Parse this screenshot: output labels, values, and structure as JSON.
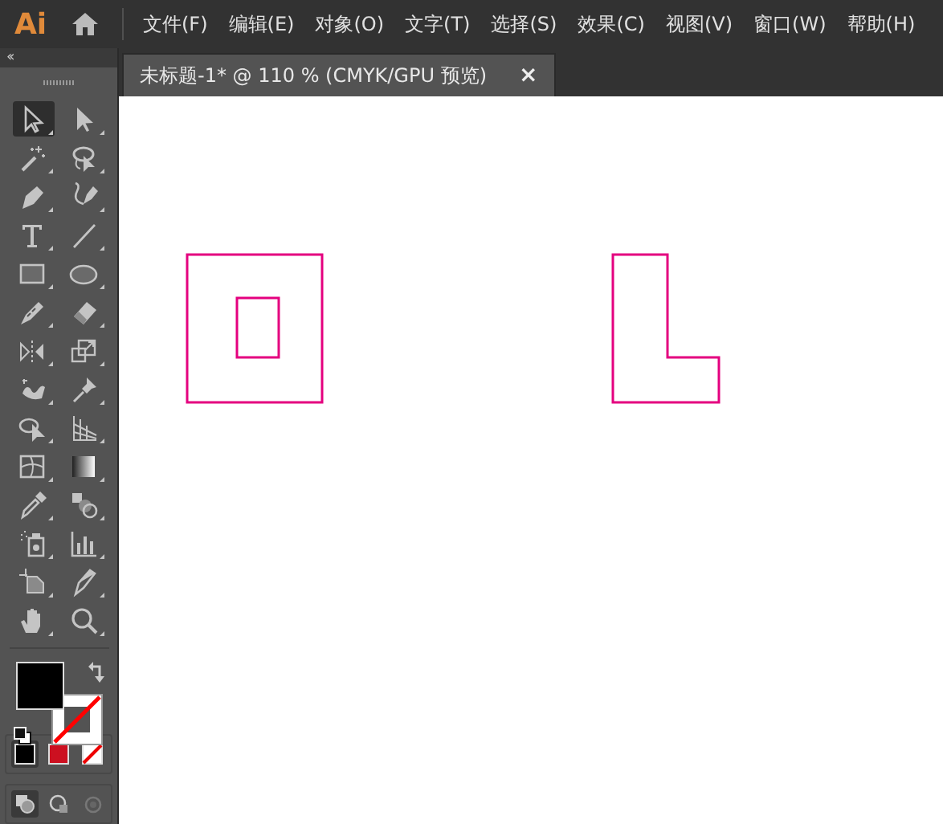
{
  "app_logo": "Ai",
  "menu": [
    "文件(F)",
    "编辑(E)",
    "对象(O)",
    "文字(T)",
    "选择(S)",
    "效果(C)",
    "视图(V)",
    "窗口(W)",
    "帮助(H)"
  ],
  "panel_collapse": "‹‹",
  "document_tab": {
    "title": "未标题-1* @ 110 % (CMYK/GPU 预览)",
    "close": "×",
    "selected": true
  },
  "tools": [
    {
      "kind": "selection",
      "selected": true
    },
    {
      "kind": "direct",
      "selected": false
    },
    {
      "kind": "wand",
      "selected": false
    },
    {
      "kind": "lasso",
      "selected": false
    },
    {
      "kind": "pen",
      "selected": false
    },
    {
      "kind": "curvature",
      "selected": false
    },
    {
      "kind": "type",
      "selected": false
    },
    {
      "kind": "line",
      "selected": false
    },
    {
      "kind": "rect",
      "selected": false
    },
    {
      "kind": "ellipse",
      "selected": false
    },
    {
      "kind": "brush",
      "selected": false
    },
    {
      "kind": "eraser",
      "selected": false
    },
    {
      "kind": "reflect",
      "selected": false
    },
    {
      "kind": "scale",
      "selected": false
    },
    {
      "kind": "warp",
      "selected": false
    },
    {
      "kind": "pin",
      "selected": false
    },
    {
      "kind": "shapebuilder",
      "selected": false
    },
    {
      "kind": "perspective",
      "selected": false
    },
    {
      "kind": "mesh",
      "selected": false
    },
    {
      "kind": "gradient",
      "selected": false
    },
    {
      "kind": "eyedropper",
      "selected": false
    },
    {
      "kind": "blend",
      "selected": false
    },
    {
      "kind": "sprayer",
      "selected": false
    },
    {
      "kind": "graph",
      "selected": false
    },
    {
      "kind": "artboard",
      "selected": false
    },
    {
      "kind": "slice",
      "selected": false
    },
    {
      "kind": "hand",
      "selected": false
    },
    {
      "kind": "zoom",
      "selected": false
    }
  ],
  "fill_swatch": {
    "color": "#000000"
  },
  "stroke_none": true,
  "color_modes": [
    {
      "kind": "color",
      "color": "#000000",
      "selected": true
    },
    {
      "kind": "gradient",
      "color": "#cc1020",
      "selected": false
    },
    {
      "kind": "none",
      "selected": false
    }
  ],
  "draw_modes": [
    {
      "kind": "normal",
      "selected": true
    },
    {
      "kind": "behind",
      "selected": false
    },
    {
      "kind": "inside",
      "selected": false
    }
  ],
  "shapes": {
    "square_frame": {
      "color": "#e4007f"
    },
    "l_shape": {
      "color": "#e4007f"
    }
  }
}
